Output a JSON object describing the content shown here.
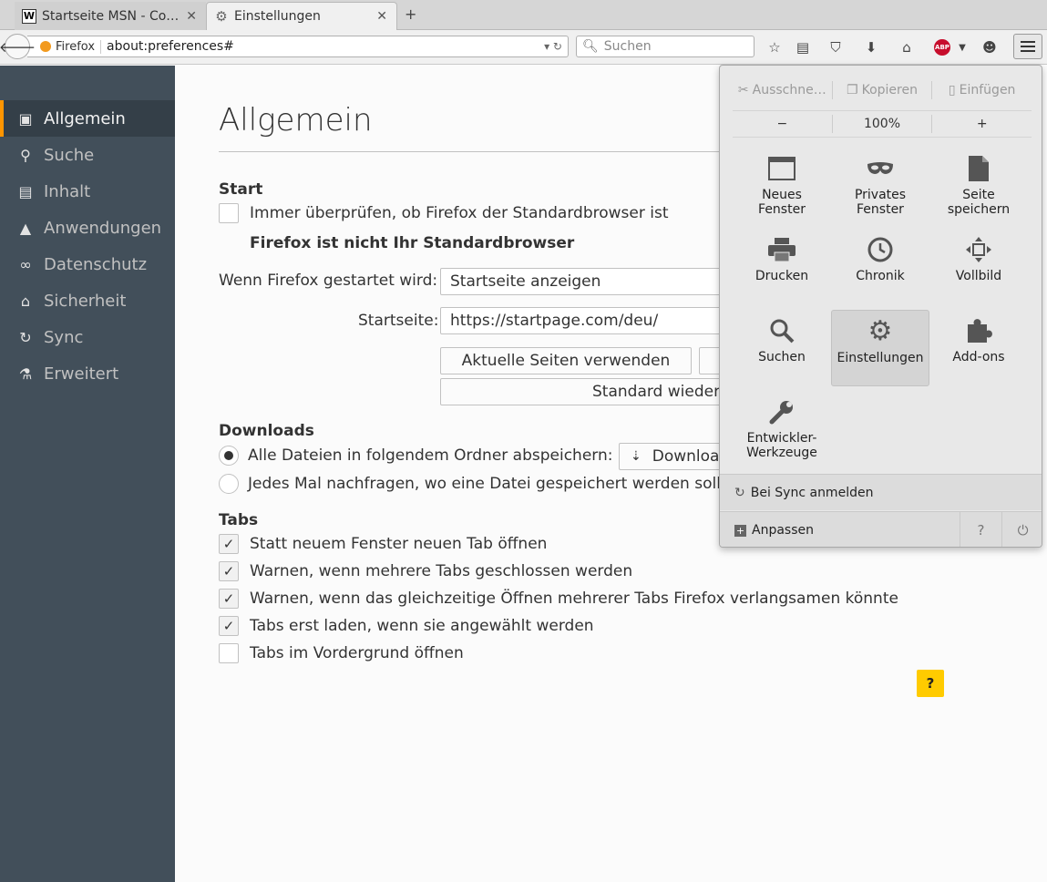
{
  "tabs": [
    {
      "favicon": "W",
      "title": "Startseite MSN - Co…",
      "close": "✕"
    },
    {
      "favicon": "⚙",
      "title": "Einstellungen",
      "close": "✕"
    }
  ],
  "new_tab": "+",
  "navbar": {
    "identity_label": "Firefox",
    "url": "about:preferences#",
    "search_placeholder": "Suchen"
  },
  "sidebar": {
    "items": [
      {
        "label": "Allgemein",
        "icon": "general-icon"
      },
      {
        "label": "Suche",
        "icon": "search-icon"
      },
      {
        "label": "Inhalt",
        "icon": "content-icon"
      },
      {
        "label": "Anwendungen",
        "icon": "applications-icon"
      },
      {
        "label": "Datenschutz",
        "icon": "privacy-mask-icon"
      },
      {
        "label": "Sicherheit",
        "icon": "security-lock-icon"
      },
      {
        "label": "Sync",
        "icon": "sync-icon"
      },
      {
        "label": "Erweitert",
        "icon": "advanced-wizard-icon"
      }
    ]
  },
  "main": {
    "title": "Allgemein",
    "start": {
      "heading": "Start",
      "check_default_label": "Immer überprüfen, ob Firefox der Standardbrowser ist",
      "check_default_checked": false,
      "not_default_note": "Firefox ist nicht Ihr Standardbrowser",
      "when_started_label": "Wenn Firefox gestartet wird:",
      "when_started_value": "Startseite anzeigen",
      "homepage_label": "Startseite:",
      "homepage_value": "https://startpage.com/deu/",
      "use_current_button": "Aktuelle Seiten verwenden",
      "restore_default_button": "Standard wiederherstellen"
    },
    "downloads": {
      "heading": "Downloads",
      "save_to_label": "Alle Dateien in folgendem Ordner abspeichern:",
      "folder_value": "Downloads",
      "ask_label": "Jedes Mal nachfragen, wo eine Datei gespeichert werden soll",
      "selected": "save_to"
    },
    "tabs_section": {
      "heading": "Tabs",
      "options": [
        {
          "label": "Statt neuem Fenster neuen Tab öffnen",
          "checked": true
        },
        {
          "label": "Warnen, wenn mehrere Tabs geschlossen werden",
          "checked": true
        },
        {
          "label": "Warnen, wenn das gleichzeitige Öffnen mehrerer Tabs Firefox verlangsamen könnte",
          "checked": true
        },
        {
          "label": "Tabs erst laden, wenn sie angewählt werden",
          "checked": true
        },
        {
          "label": "Tabs im Vordergrund öffnen",
          "checked": false
        }
      ]
    },
    "help_button": "?"
  },
  "menu_panel": {
    "edit": {
      "cut": "Ausschne…",
      "copy": "Kopieren",
      "paste": "Einfügen"
    },
    "zoom": {
      "minus": "−",
      "level": "100%",
      "plus": "+"
    },
    "tiles": [
      {
        "label": "Neues\nFenster",
        "icon": "new-window-icon"
      },
      {
        "label": "Privates\nFenster",
        "icon": "private-window-mask-icon"
      },
      {
        "label": "Seite\nspeichern",
        "icon": "save-page-icon"
      },
      {
        "label": "Drucken",
        "icon": "print-icon"
      },
      {
        "label": "Chronik",
        "icon": "history-clock-icon"
      },
      {
        "label": "Vollbild",
        "icon": "fullscreen-icon"
      },
      {
        "label": "Suchen",
        "icon": "find-icon"
      },
      {
        "label": "Einstellungen",
        "icon": "preferences-gear-icon"
      },
      {
        "label": "Add-ons",
        "icon": "addons-puzzle-icon"
      },
      {
        "label": "Entwickler-\nWerkzeuge",
        "icon": "developer-wrench-icon"
      }
    ],
    "sync_label": "Bei Sync anmelden",
    "customize_label": "Anpassen",
    "help_icon": "?",
    "quit_icon": "⏻"
  },
  "colors": {
    "sidebar_bg": "#424f5a",
    "sidebar_active_bg": "#343f48",
    "accent": "#ff9500",
    "help_yellow": "#ffcb00"
  }
}
